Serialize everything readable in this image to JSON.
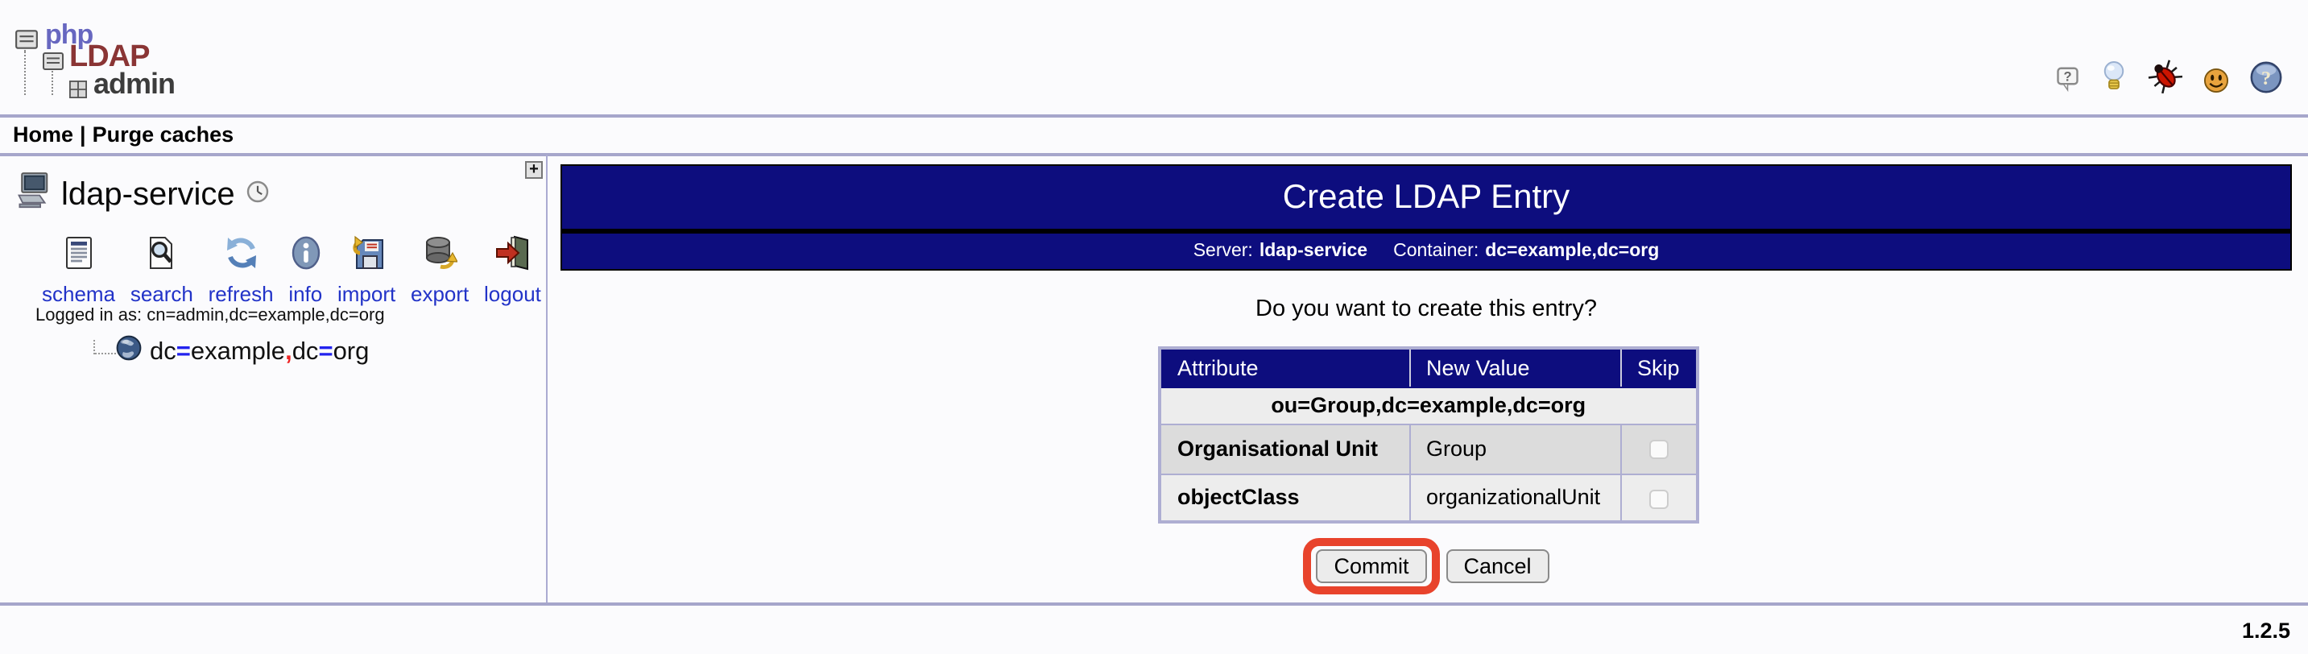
{
  "logo": {
    "php": "php",
    "ldap": "LDAP",
    "admin": "admin"
  },
  "header_icons": [
    {
      "name": "question-bubble-icon"
    },
    {
      "name": "light-bulb-icon"
    },
    {
      "name": "bug-icon"
    },
    {
      "name": "smiley-icon"
    },
    {
      "name": "help-icon"
    }
  ],
  "nav": {
    "home": "Home",
    "separator": "|",
    "purge_caches": "Purge caches"
  },
  "sidebar": {
    "server_name": "ldap-service",
    "expand_button": "+",
    "tools": [
      {
        "label": "schema",
        "icon": "schema-document-icon"
      },
      {
        "label": "search",
        "icon": "search-document-icon"
      },
      {
        "label": "refresh",
        "icon": "refresh-arrows-icon"
      },
      {
        "label": "info",
        "icon": "info-circle-icon"
      },
      {
        "label": "import",
        "icon": "import-floppy-icon"
      },
      {
        "label": "export",
        "icon": "export-database-icon"
      },
      {
        "label": "logout",
        "icon": "logout-door-icon"
      }
    ],
    "logged_in_as": "Logged in as: cn=admin,dc=example,dc=org",
    "tree_item": {
      "dc1": "dc",
      "eq1": "=",
      "val1": "example",
      "comma": ",",
      "dc2": "dc",
      "eq2": "=",
      "val2": "org"
    }
  },
  "main": {
    "title": "Create LDAP Entry",
    "server_label": "Server:",
    "server_value": "ldap-service",
    "container_label": "Container:",
    "container_value": "dc=example,dc=org",
    "question": "Do you want to create this entry?",
    "table": {
      "headers": [
        "Attribute",
        "New Value",
        "Skip"
      ],
      "dn": "ou=Group,dc=example,dc=org",
      "rows": [
        {
          "attribute": "Organisational Unit",
          "new_value": "Group",
          "skip_checked": false
        },
        {
          "attribute": "objectClass",
          "new_value": "organizationalUnit",
          "skip_checked": false
        }
      ]
    },
    "commit_label": "Commit",
    "cancel_label": "Cancel"
  },
  "footer": {
    "version": "1.2.5"
  },
  "colors": {
    "navy": "#0d0d7e",
    "highlight_red": "#e8432c",
    "link_blue": "#2233c8",
    "tree_equals_blue": "#2222ee",
    "tree_comma_red": "#ee2222",
    "divider_purple": "#a6a6cb"
  }
}
